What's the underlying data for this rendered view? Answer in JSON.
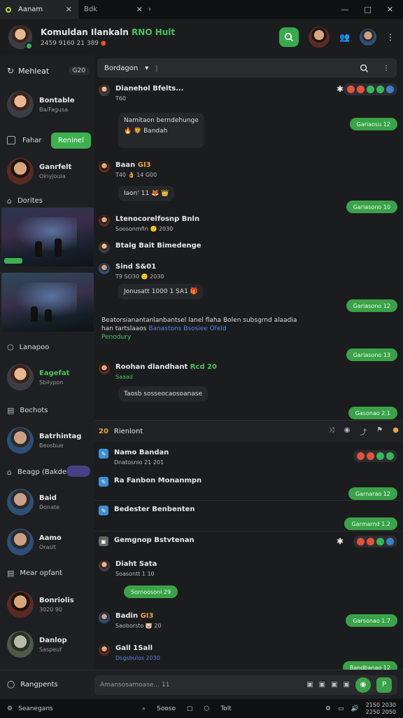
{
  "window": {
    "tabs": [
      {
        "label": "Aanam",
        "close": "✕"
      },
      {
        "label": "Bdk",
        "close": "✕"
      }
    ],
    "tab_more": "›",
    "controls": [
      "—",
      "□",
      "✕"
    ]
  },
  "header": {
    "title": "Komuldan Ilankaln",
    "title_tag": "RNO Hult",
    "subtitle": "2459 9160 21 389",
    "icons": [
      "search-icon",
      "people-icon",
      "avatar"
    ]
  },
  "sidebar": {
    "header_label": "Mehleat",
    "header_count": "G20",
    "toggle": {
      "label": "Fahar",
      "button": "Reninel"
    },
    "contacts": [
      {
        "name": "Bontable",
        "sub": "Ba/Fagusa"
      },
      {
        "name": "Ganrfelt",
        "sub": "Oinyjoula"
      },
      {
        "name": "Eagefat",
        "sub": "Sbilypon"
      },
      {
        "name": "Batrhintag",
        "sub": "Beosbue"
      },
      {
        "name": "Baid",
        "sub": "Donate"
      },
      {
        "name": "Aamo",
        "sub": "Oraslt"
      },
      {
        "name": "Bonriolis",
        "sub": "3020 90"
      },
      {
        "name": "Danlop",
        "sub": "Saspeuf"
      }
    ],
    "sections": [
      "Dorites",
      "Lanapoo",
      "Bochots",
      "Beagp (Bakde",
      "Mear opfant"
    ]
  },
  "chat": {
    "search_label": "Bordagon",
    "search_arrow": "▾",
    "search_divider": "|",
    "messages": [
      {
        "who": "Dianehol Bfelts...",
        "sub": "T60"
      },
      {
        "who": "Baan",
        "tag": "GI3",
        "sub": "T40 👌 14 G00"
      },
      {
        "who": "Ltenocorelfosnp Bnln",
        "sub": "Soosonmfin 🙂 2030"
      },
      {
        "who": "Btalg Bait Bimedenge",
        "sub": ""
      },
      {
        "who": "Sind S&01",
        "sub": "T9 SO30 🙂 2030"
      },
      {
        "who": "Roohan dlandhant",
        "tag": "Rcd 20",
        "sub": "Saaad"
      }
    ],
    "bubbles": [
      "Namitaon berndehunge",
      "🔥 🦁 Bandah",
      "Iaon' 11 🦊 👑",
      "Jonusatt 1000 1 SA1 🎁",
      "Taosb sosseocaosoanase"
    ],
    "long_text": {
      "line1": "Beatorsianantanlanbantsel lanel flaha Bolen subsgrnd alaadia",
      "line2a": "han tartslaaos ",
      "line2b": "Banastons Bsosiee Ofeld",
      "line3": "Penodury"
    },
    "pills": [
      "Gariaosu 12",
      "Gariasono 10",
      "Gariasono 12",
      "Gariasono 13",
      "Gasonao 2.1",
      "Garnarao 12",
      "Garmarnd 1.2",
      "Garsonao 1.7",
      "Bandbanao 12"
    ],
    "thread": {
      "count": "20",
      "title": "Rienlont",
      "items": [
        {
          "who": "Namo Bandan",
          "sub": "Dnatosnio 21 201"
        },
        {
          "who": "Ra Fanbon Monanmpn",
          "sub": ""
        },
        {
          "who": "Bedester Benbenten",
          "sub": ""
        },
        {
          "who": "Gemgnop Bstvtenan",
          "sub": ""
        },
        {
          "who": "Diaht Sata",
          "sub": "Soasontt 1 10"
        },
        {
          "who": "Badin",
          "tag": "GI3",
          "sub": "Saoborsto 🐷 20"
        },
        {
          "who": "Gall 1Sall",
          "sub": "Dsgsbulos 2030"
        }
      ],
      "green_chip": "Sornoosoni 29"
    }
  },
  "composer": {
    "left_label": "Rangpents",
    "placeholder": "Amansosamoase... 11"
  },
  "bottombar": {
    "left": "Seanegans",
    "middle": [
      "Sooso",
      "Tolt"
    ],
    "right_top": "2150 2030",
    "right_bottom": "2250 2050"
  },
  "colors": {
    "accent": "#3ba24a",
    "background": "#1b1c1e",
    "link": "#5d82e8"
  }
}
